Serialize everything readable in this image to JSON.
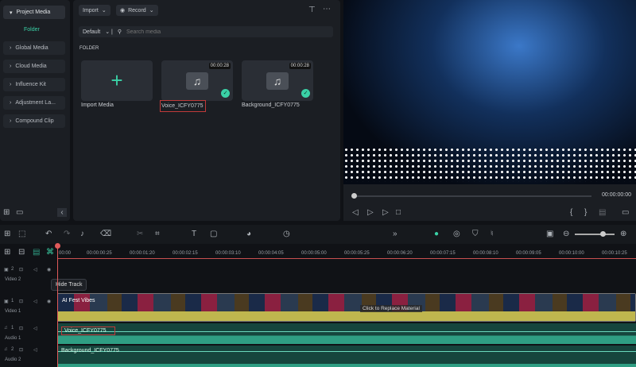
{
  "sidebar": {
    "items": [
      {
        "label": "Project Media",
        "active": true
      },
      {
        "label": "Global Media"
      },
      {
        "label": "Cloud Media"
      },
      {
        "label": "Influence Kit"
      },
      {
        "label": "Adjustment La..."
      },
      {
        "label": "Compound Clip"
      }
    ],
    "folder": "Folder"
  },
  "media": {
    "import": "Import",
    "record": "Record",
    "sort": "Default",
    "search_placeholder": "Search media",
    "section": "FOLDER",
    "items": [
      {
        "label": "Import Media"
      },
      {
        "label": "Voice_ICFY0775",
        "duration": "00:00:28"
      },
      {
        "label": "Background_ICFY0775",
        "duration": "00:00:28"
      }
    ]
  },
  "player": {
    "time": "00:00:00:00",
    "progress": 0
  },
  "ruler": [
    "00:00",
    "00:00:00:25",
    "00:00:01:20",
    "00:00:02:15",
    "00:00:03:10",
    "00:00:04:05",
    "00:00:05:00",
    "00:00:05:25",
    "00:00:06:20",
    "00:00:07:15",
    "00:00:08:10",
    "00:00:09:05",
    "00:00:10:00",
    "00:00:10:25"
  ],
  "tracks": {
    "video2": {
      "num": "2",
      "name": "Video 2"
    },
    "video1": {
      "num": "1",
      "name": "Video 1",
      "clip": "AI Fest Vibes",
      "overlay": "Click to Replace Material"
    },
    "audio1": {
      "num": "1",
      "name": "Audio 1",
      "clip": "Voice_ICFY0775"
    },
    "audio2": {
      "num": "2",
      "name": "Audio 2",
      "clip": "Background_ICFY0775"
    }
  },
  "tooltip": "Hide Track",
  "colors": {
    "accent": "#3ad1a6",
    "playhead": "#e05a5a",
    "audio": "#2f9e83",
    "video_audio": "#cfc35a"
  }
}
